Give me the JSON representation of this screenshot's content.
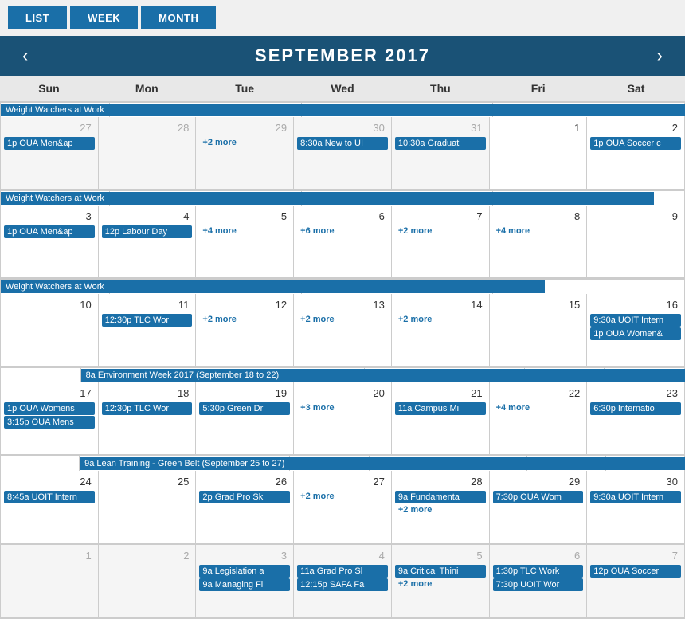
{
  "header": {
    "title": "SEPTEMBER 2017",
    "prev_label": "‹",
    "next_label": "›"
  },
  "view_buttons": [
    {
      "label": "LIST",
      "id": "list"
    },
    {
      "label": "WEEK",
      "id": "week"
    },
    {
      "label": "MONTH",
      "id": "month"
    }
  ],
  "days_of_week": [
    "Sun",
    "Mon",
    "Tue",
    "Wed",
    "Thu",
    "Fri",
    "Sat"
  ],
  "weeks": [
    {
      "span_event": "Weight Watchers at Work",
      "span_start": 0,
      "span_end": 6,
      "days": [
        {
          "date": "27",
          "other": true,
          "events": [
            {
              "text": "1p OUA Men&ap",
              "type": "blue"
            }
          ]
        },
        {
          "date": "28",
          "other": true,
          "events": []
        },
        {
          "date": "29",
          "other": true,
          "events": [
            {
              "text": "+2 more",
              "type": "more"
            }
          ]
        },
        {
          "date": "30",
          "other": true,
          "events": [
            {
              "text": "8:30a New to UI",
              "type": "blue"
            }
          ]
        },
        {
          "date": "31",
          "other": true,
          "events": [
            {
              "text": "10:30a Graduat",
              "type": "blue"
            }
          ]
        },
        {
          "date": "1",
          "other": false,
          "events": []
        },
        {
          "date": "2",
          "other": false,
          "events": [
            {
              "text": "1p OUA Soccer c",
              "type": "blue"
            }
          ]
        }
      ]
    },
    {
      "span_event": "Weight Watchers at Work",
      "span_start": 0,
      "span_end": 5,
      "days": [
        {
          "date": "3",
          "other": false,
          "events": [
            {
              "text": "1p OUA Men&ap",
              "type": "blue"
            }
          ]
        },
        {
          "date": "4",
          "other": false,
          "events": [
            {
              "text": "12p Labour Day",
              "type": "blue"
            }
          ]
        },
        {
          "date": "5",
          "other": false,
          "events": [
            {
              "text": "+4 more",
              "type": "more"
            }
          ]
        },
        {
          "date": "6",
          "other": false,
          "events": [
            {
              "text": "+6 more",
              "type": "more"
            }
          ]
        },
        {
          "date": "7",
          "other": false,
          "events": [
            {
              "text": "+2 more",
              "type": "more"
            }
          ]
        },
        {
          "date": "8",
          "other": false,
          "events": [
            {
              "text": "+4 more",
              "type": "more"
            }
          ]
        },
        {
          "date": "9",
          "other": false,
          "events": []
        }
      ]
    },
    {
      "span_event": "Weight Watchers at Work",
      "span_start": 0,
      "span_end": 4,
      "days": [
        {
          "date": "10",
          "other": false,
          "events": []
        },
        {
          "date": "11",
          "other": false,
          "events": [
            {
              "text": "12:30p TLC Wor",
              "type": "blue"
            }
          ]
        },
        {
          "date": "12",
          "other": false,
          "events": [
            {
              "text": "+2 more",
              "type": "more"
            }
          ]
        },
        {
          "date": "13",
          "other": false,
          "events": [
            {
              "text": "+2 more",
              "type": "more"
            }
          ]
        },
        {
          "date": "14",
          "other": false,
          "events": [
            {
              "text": "+2 more",
              "type": "more"
            }
          ]
        },
        {
          "date": "15",
          "other": false,
          "events": []
        },
        {
          "date": "16",
          "other": false,
          "events": [
            {
              "text": "9:30a UOIT Intern",
              "type": "blue"
            },
            {
              "text": "1p OUA Women&",
              "type": "blue"
            }
          ]
        }
      ]
    },
    {
      "span_event": "8a Environment Week 2017 (September 18 to 22)",
      "span_start": 1,
      "span_end": 5,
      "days": [
        {
          "date": "17",
          "other": false,
          "events": [
            {
              "text": "1p OUA Womens",
              "type": "blue"
            },
            {
              "text": "3:15p OUA Mens",
              "type": "blue"
            }
          ]
        },
        {
          "date": "18",
          "other": false,
          "events": [
            {
              "text": "12:30p TLC Wor",
              "type": "blue"
            }
          ]
        },
        {
          "date": "19",
          "other": false,
          "events": [
            {
              "text": "5:30p Green Dr",
              "type": "blue"
            }
          ]
        },
        {
          "date": "20",
          "other": false,
          "events": [
            {
              "text": "+3 more",
              "type": "more"
            }
          ]
        },
        {
          "date": "21",
          "other": false,
          "events": [
            {
              "text": "11a Campus Mi",
              "type": "blue"
            }
          ]
        },
        {
          "date": "22",
          "other": false,
          "events": [
            {
              "text": "+4 more",
              "type": "more"
            }
          ]
        },
        {
          "date": "23",
          "other": false,
          "events": [
            {
              "text": "6:30p Internatio",
              "type": "blue"
            }
          ]
        }
      ]
    },
    {
      "span_event": "9a Lean Training - Green Belt (September 25 to 27)",
      "span_start": 1,
      "span_end": 3,
      "days": [
        {
          "date": "24",
          "other": false,
          "events": [
            {
              "text": "8:45a UOIT Intern",
              "type": "blue"
            }
          ]
        },
        {
          "date": "25",
          "other": false,
          "events": []
        },
        {
          "date": "26",
          "other": false,
          "events": [
            {
              "text": "2p Grad Pro Sk",
              "type": "blue"
            }
          ]
        },
        {
          "date": "27",
          "other": false,
          "events": [
            {
              "text": "+2 more",
              "type": "more"
            }
          ]
        },
        {
          "date": "28",
          "other": false,
          "events": [
            {
              "text": "9a Fundamenta",
              "type": "blue"
            },
            {
              "text": "+2 more",
              "type": "more"
            }
          ]
        },
        {
          "date": "29",
          "other": false,
          "events": [
            {
              "text": "7:30p OUA Wom",
              "type": "blue"
            }
          ]
        },
        {
          "date": "30",
          "other": false,
          "events": [
            {
              "text": "9:30a UOIT Intern",
              "type": "blue"
            }
          ]
        }
      ]
    },
    {
      "span_event": null,
      "days": [
        {
          "date": "1",
          "other": true,
          "events": []
        },
        {
          "date": "2",
          "other": true,
          "events": []
        },
        {
          "date": "3",
          "other": true,
          "events": [
            {
              "text": "9a Legislation a",
              "type": "blue"
            },
            {
              "text": "9a Managing Fi",
              "type": "blue"
            }
          ]
        },
        {
          "date": "4",
          "other": true,
          "events": [
            {
              "text": "11a Grad Pro Sl",
              "type": "blue"
            },
            {
              "text": "12:15p SAFA Fa",
              "type": "blue"
            }
          ]
        },
        {
          "date": "5",
          "other": true,
          "events": [
            {
              "text": "9a Critical Thini",
              "type": "blue"
            },
            {
              "text": "+2 more",
              "type": "more"
            }
          ]
        },
        {
          "date": "6",
          "other": true,
          "events": [
            {
              "text": "1:30p TLC Work",
              "type": "blue"
            },
            {
              "text": "7:30p UOIT Wor",
              "type": "blue"
            }
          ]
        },
        {
          "date": "7",
          "other": true,
          "events": [
            {
              "text": "12p OUA Soccer",
              "type": "blue"
            }
          ]
        }
      ]
    }
  ]
}
